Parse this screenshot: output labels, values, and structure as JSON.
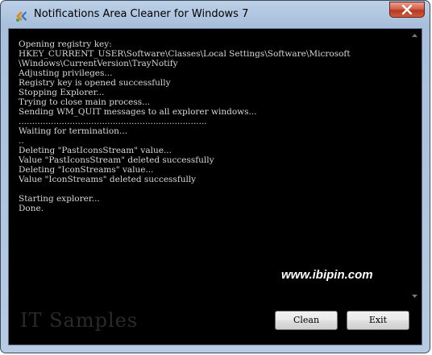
{
  "window": {
    "title": "Notifications Area Cleaner for Windows 7",
    "close_icon": "close-x-icon",
    "app_icon": "notification-cleaner-app-icon"
  },
  "log": {
    "lines": [
      "Opening registry key:",
      "HKEY_CURRENT_USER\\Software\\Classes\\Local Settings\\Software\\Microsoft",
      "\\Windows\\CurrentVersion\\TrayNotify",
      "Adjusting privileges...",
      "Registry key is opened successfully",
      "Stopping Explorer...",
      "Trying to close main process...",
      "Sending WM_QUIT messages to all explorer windows...",
      "......................................................................",
      "Waiting for termination...",
      "..",
      "Deleting \"PastIconsStream\" value...",
      "Value \"PastIconsStream\" deleted successfully",
      "Deleting \"IconStreams\" value...",
      "Value \"IconStreams\" deleted successfully",
      "",
      "Starting explorer...",
      "Done."
    ]
  },
  "watermark": {
    "url": "www.ibipin.com",
    "samples": "IT Samples"
  },
  "buttons": {
    "clean_label": "Clean",
    "exit_label": "Exit"
  },
  "colors": {
    "console_bg": "#000000",
    "console_text": "#d8d8d8",
    "frame": "#b7cbe3",
    "close_button": "#c9452a"
  }
}
